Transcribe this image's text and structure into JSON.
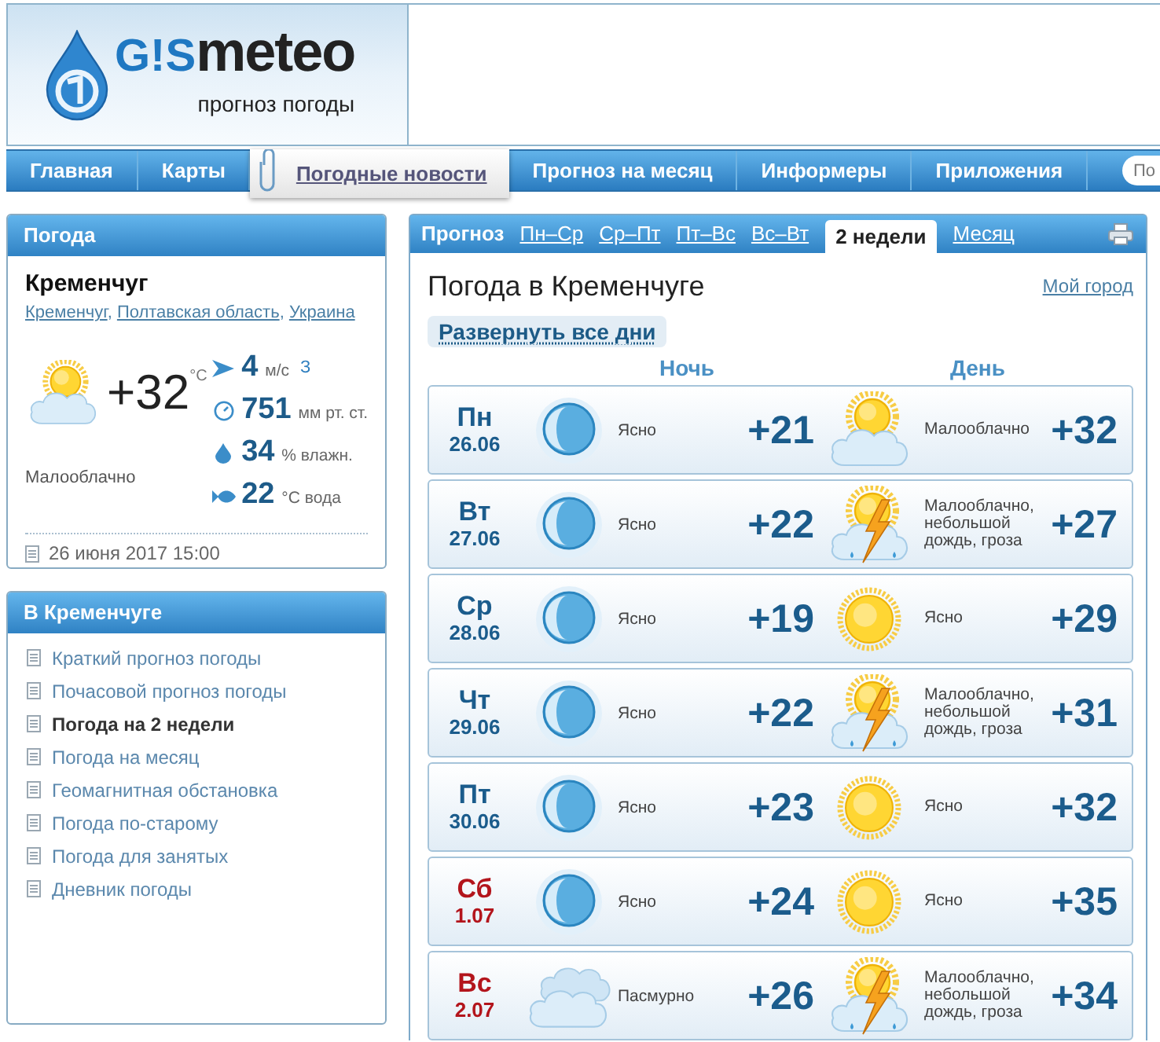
{
  "header": {
    "logo": {
      "mark": "G!S",
      "word": "meteo",
      "tagline": "прогноз погоды"
    }
  },
  "nav": {
    "items": [
      {
        "label": "Главная",
        "selected": false
      },
      {
        "label": "Карты",
        "selected": false
      },
      {
        "label": "Погодные новости",
        "selected": true
      },
      {
        "label": "Прогноз на месяц",
        "selected": false
      },
      {
        "label": "Информеры",
        "selected": false
      },
      {
        "label": "Приложения",
        "selected": false
      }
    ],
    "search": {
      "placeholder": "По"
    }
  },
  "weather_panel": {
    "title": "Погода",
    "city": "Кременчуг",
    "location": {
      "links": [
        "Кременчуг",
        "Полтавская область",
        "Украина"
      ],
      "separator": ","
    },
    "kind": "partly_cloudy",
    "temperature": "+32",
    "unit": "°C",
    "condition": "Малооблачно",
    "stats": [
      {
        "kind": "wind",
        "value": "4",
        "unit": "м/с",
        "direction": "З"
      },
      {
        "kind": "pressure",
        "value": "751",
        "unit": "мм рт. ст."
      },
      {
        "kind": "humidity",
        "value": "34",
        "unit": "% влажн."
      },
      {
        "kind": "water",
        "value": "22",
        "unit": "°C вода"
      }
    ],
    "updated": "26 июня 2017 15:00"
  },
  "city_panel": {
    "title": "В Кременчуге",
    "items": [
      {
        "label": "Краткий прогноз погоды",
        "selected": false
      },
      {
        "label": "Почасовой прогноз погоды",
        "selected": false
      },
      {
        "label": "Погода на 2 недели",
        "selected": true
      },
      {
        "label": "Погода на месяц",
        "selected": false
      },
      {
        "label": "Геомагнитная обстановка",
        "selected": false
      },
      {
        "label": "Погода по-старому",
        "selected": false
      },
      {
        "label": "Погода для занятых",
        "selected": false
      },
      {
        "label": "Дневник погоды",
        "selected": false
      }
    ]
  },
  "forecast": {
    "label": "Прогноз",
    "tabs": [
      {
        "label": "Пн–Ср",
        "selected": false
      },
      {
        "label": "Ср–Пт",
        "selected": false
      },
      {
        "label": "Пт–Вс",
        "selected": false
      },
      {
        "label": "Вс–Вт",
        "selected": false
      },
      {
        "label": "2 недели",
        "selected": true
      },
      {
        "label": "Месяц",
        "selected": false
      }
    ],
    "title": "Погода в Кременчуге",
    "my_city": "Мой город",
    "expand": "Развернуть все дни",
    "night_heading": "Ночь",
    "day_heading": "День",
    "days": [
      {
        "weekday": "Пн",
        "date": "26.06",
        "weekend": false,
        "night": {
          "kind": "clear",
          "description": "Ясно",
          "temperature": "+21"
        },
        "day": {
          "kind": "partly_cloudy",
          "description": "Малооблачно",
          "temperature": "+32"
        }
      },
      {
        "weekday": "Вт",
        "date": "27.06",
        "weekend": false,
        "night": {
          "kind": "clear",
          "description": "Ясно",
          "temperature": "+22"
        },
        "day": {
          "kind": "thunderstorm",
          "description": "Малооблачно, небольшой дождь, гроза",
          "temperature": "+27"
        }
      },
      {
        "weekday": "Ср",
        "date": "28.06",
        "weekend": false,
        "night": {
          "kind": "clear",
          "description": "Ясно",
          "temperature": "+19"
        },
        "day": {
          "kind": "clear",
          "description": "Ясно",
          "temperature": "+29"
        }
      },
      {
        "weekday": "Чт",
        "date": "29.06",
        "weekend": false,
        "night": {
          "kind": "clear",
          "description": "Ясно",
          "temperature": "+22"
        },
        "day": {
          "kind": "thunderstorm",
          "description": "Малооблачно, небольшой дождь, гроза",
          "temperature": "+31"
        }
      },
      {
        "weekday": "Пт",
        "date": "30.06",
        "weekend": false,
        "night": {
          "kind": "clear",
          "description": "Ясно",
          "temperature": "+23"
        },
        "day": {
          "kind": "clear",
          "description": "Ясно",
          "temperature": "+32"
        }
      },
      {
        "weekday": "Сб",
        "date": "1.07",
        "weekend": true,
        "night": {
          "kind": "clear",
          "description": "Ясно",
          "temperature": "+24"
        },
        "day": {
          "kind": "clear",
          "description": "Ясно",
          "temperature": "+35"
        }
      },
      {
        "weekday": "Вс",
        "date": "2.07",
        "weekend": true,
        "night": {
          "kind": "overcast",
          "description": "Пасмурно",
          "temperature": "+26"
        },
        "day": {
          "kind": "thunderstorm",
          "description": "Малооблачно, небольшой дождь, гроза",
          "temperature": "+34"
        }
      }
    ]
  }
}
